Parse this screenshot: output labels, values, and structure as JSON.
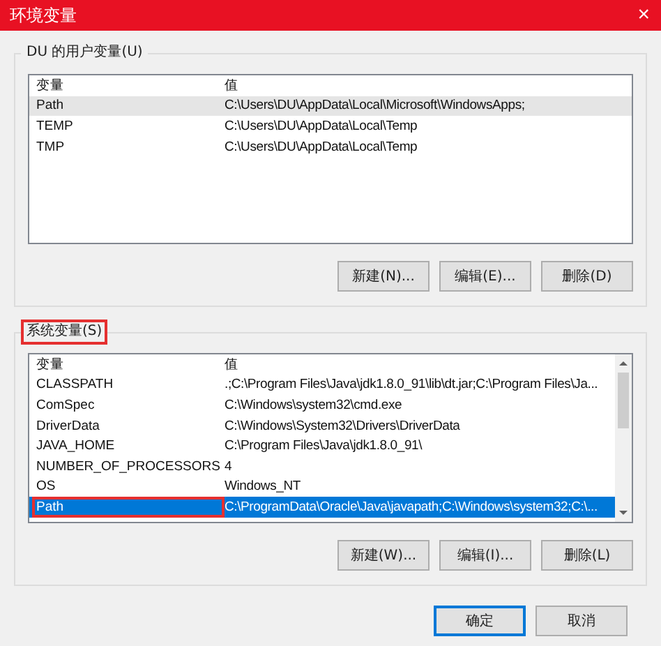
{
  "window": {
    "title": "环境变量",
    "close": "×"
  },
  "groups": [
    {
      "label": "DU 的用户变量(U)",
      "annotated": false,
      "focused": false,
      "scrollbar": false,
      "columns": [
        "变量",
        "值"
      ],
      "rows": [
        {
          "name": "Path",
          "value": "C:\\Users\\DU\\AppData\\Local\\Microsoft\\WindowsApps;",
          "selected": true,
          "annotated": false
        },
        {
          "name": "TEMP",
          "value": "C:\\Users\\DU\\AppData\\Local\\Temp",
          "selected": false,
          "annotated": false
        },
        {
          "name": "TMP",
          "value": "C:\\Users\\DU\\AppData\\Local\\Temp",
          "selected": false,
          "annotated": false
        }
      ],
      "buttons": [
        "新建(N)...",
        "编辑(E)...",
        "删除(D)"
      ]
    },
    {
      "label": "系统变量(S)",
      "annotated": true,
      "focused": true,
      "scrollbar": true,
      "columns": [
        "变量",
        "值"
      ],
      "rows": [
        {
          "name": "CLASSPATH",
          "value": ".;C:\\Program Files\\Java\\jdk1.8.0_91\\lib\\dt.jar;C:\\Program Files\\Ja...",
          "selected": false,
          "annotated": false
        },
        {
          "name": "ComSpec",
          "value": "C:\\Windows\\system32\\cmd.exe",
          "selected": false,
          "annotated": false
        },
        {
          "name": "DriverData",
          "value": "C:\\Windows\\System32\\Drivers\\DriverData",
          "selected": false,
          "annotated": false
        },
        {
          "name": "JAVA_HOME",
          "value": "C:\\Program Files\\Java\\jdk1.8.0_91\\",
          "selected": false,
          "annotated": false
        },
        {
          "name": "NUMBER_OF_PROCESSORS",
          "value": "4",
          "selected": false,
          "annotated": false
        },
        {
          "name": "OS",
          "value": "Windows_NT",
          "selected": false,
          "annotated": false
        },
        {
          "name": "Path",
          "value": "C:\\ProgramData\\Oracle\\Java\\javapath;C:\\Windows\\system32;C:\\...",
          "selected": true,
          "annotated": true
        }
      ],
      "buttons": [
        "新建(W)...",
        "编辑(I)...",
        "删除(L)"
      ]
    }
  ],
  "footer_buttons": [
    {
      "label": "确定",
      "default": true
    },
    {
      "label": "取消",
      "default": false
    }
  ]
}
